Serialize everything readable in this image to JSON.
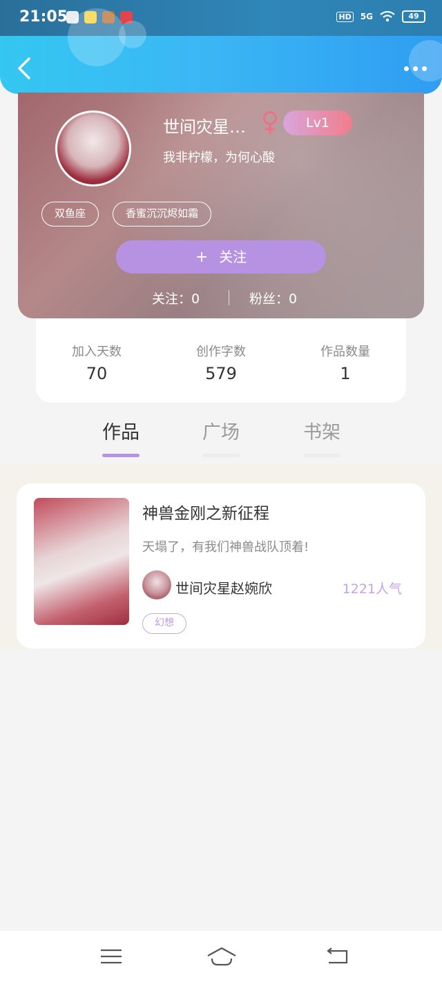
{
  "status_bar": {
    "time": "21:05",
    "network": "5G",
    "hd": "HD",
    "battery": "49"
  },
  "profile": {
    "nickname": "世间灾星…",
    "level": "Lv1",
    "signature": "我非柠檬，为何心酸",
    "tags": [
      "双鱼座",
      "香蜜沉沉烬如霜"
    ],
    "follow_button": {
      "plus": "+",
      "label": "关注"
    },
    "following": "关注：0",
    "followers": "粉丝：0"
  },
  "stats": [
    {
      "label": "加入天数",
      "value": "70"
    },
    {
      "label": "创作字数",
      "value": "579"
    },
    {
      "label": "作品数量",
      "value": "1"
    }
  ],
  "tabs": [
    "作品",
    "广场",
    "书架"
  ],
  "active_tab": "作品",
  "works": [
    {
      "title": "神兽金刚之新征程",
      "description": "天塌了，有我们神兽战队顶着!",
      "author": "世间灾星赵婉欣",
      "popularity": "1221人气",
      "genre": "幻想"
    }
  ],
  "icons": {
    "back": "chevron-left-icon",
    "more": "more-dots-icon",
    "gender": "female-icon",
    "nav": [
      "menu-icon",
      "home-icon",
      "back-icon"
    ]
  },
  "colors": {
    "header": "#3bb7f5",
    "accent": "#b792e2",
    "level_badge": "#f17d8a",
    "popularity": "#c7a3e6"
  }
}
